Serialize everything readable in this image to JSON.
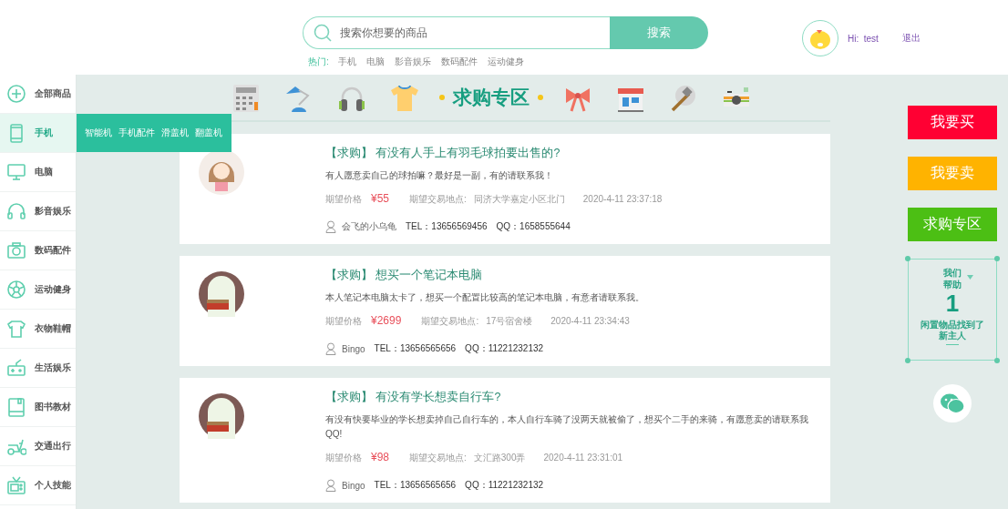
{
  "header": {
    "search": {
      "placeholder": "搜索你想要的商品",
      "button": "搜索"
    },
    "hot": {
      "label": "热门:",
      "items": [
        "手机",
        "电脑",
        "影音娱乐",
        "数码配件",
        "运动健身"
      ]
    },
    "user": {
      "greeting": "Hi:  test",
      "logout": "退出"
    }
  },
  "sidebar": {
    "items": [
      {
        "label": "全部商品",
        "expanded": false
      },
      {
        "label": "手机",
        "expanded": true,
        "children": [
          "智能机",
          "手机配件",
          "滑盖机",
          "翻盖机"
        ]
      },
      {
        "label": "电脑",
        "expanded": false
      },
      {
        "label": "影音娱乐",
        "expanded": false
      },
      {
        "label": "数码配件",
        "expanded": false
      },
      {
        "label": "运动健身",
        "expanded": false
      },
      {
        "label": "衣物鞋帽",
        "expanded": false
      },
      {
        "label": "生活娱乐",
        "expanded": false
      },
      {
        "label": "图书教材",
        "expanded": false
      },
      {
        "label": "交通出行",
        "expanded": false
      },
      {
        "label": "个人技能",
        "expanded": false
      }
    ]
  },
  "banner": {
    "title": "求购专区"
  },
  "posts": [
    {
      "tag": "【求购】",
      "title": "有没有人手上有羽毛球拍要出售的?",
      "desc": "有人愿意卖自己的球拍嘛？最好是一副，有的请联系我！",
      "price_label": "期望价格",
      "price": "¥55",
      "place_label": "期望交易地点:",
      "place": "同济大学嘉定小区北门",
      "time": "2020-4-11 23:37:18",
      "user": "会飞的小乌龟",
      "tel": "TEL：13656569456",
      "qq": "QQ：1658555644"
    },
    {
      "tag": "【求购】",
      "title": "想买一个笔记本电脑",
      "desc": "本人笔记本电脑太卡了，想买一个配置比较高的笔记本电脑，有意者请联系我。",
      "price_label": "期望价格",
      "price": "¥2699",
      "place_label": "期望交易地点:",
      "place": "17号宿舍楼",
      "time": "2020-4-11 23:34:43",
      "user": "Bingo",
      "tel": "TEL：13656565656",
      "qq": "QQ：11221232132"
    },
    {
      "tag": "【求购】",
      "title": "有没有学长想卖自行车?",
      "desc": "有没有快要毕业的学长想卖掉自己自行车的，本人自行车骑了没两天就被偷了，想买个二手的来骑，有愿意卖的请联系我QQ!",
      "price_label": "期望价格",
      "price": "¥98",
      "place_label": "期望交易地点:",
      "place": "文汇路300弄",
      "time": "2020-4-11 23:31:01",
      "user": "Bingo",
      "tel": "TEL：13656565656",
      "qq": "QQ：11221232132"
    }
  ],
  "side_buttons": [
    {
      "label": "我要买",
      "color": "#ff0033"
    },
    {
      "label": "我要卖",
      "color": "#ffb300"
    },
    {
      "label": "求购专区",
      "color": "#4cbf14"
    }
  ],
  "help": {
    "line1": "我们",
    "line2": "帮助",
    "count": "1",
    "text1": "闲置物品找到了",
    "text2": "新主人"
  }
}
